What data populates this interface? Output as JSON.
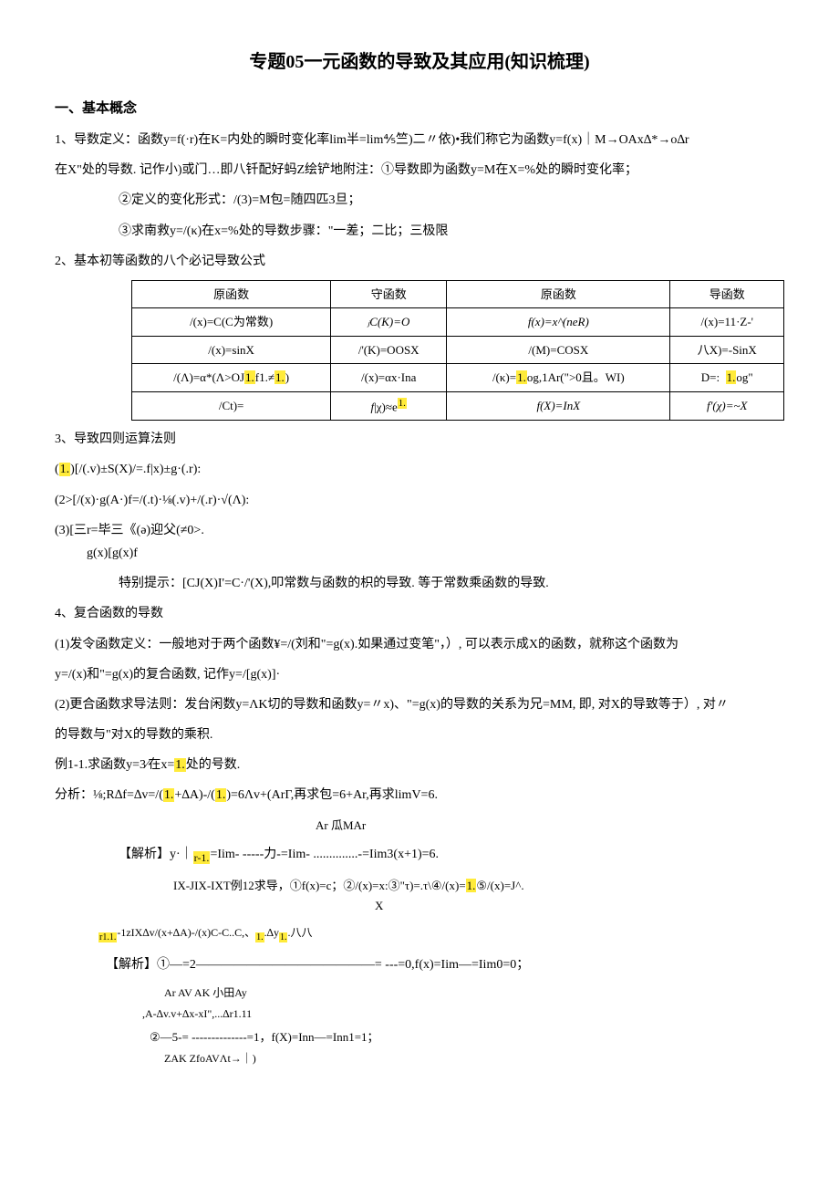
{
  "title": "专题05一元函数的导致及其应用(知识梳理)",
  "sec1": {
    "heading": "一、基本概念",
    "p1": "1、导数定义：函数y=f(·r)在K=内处的瞬时变化率lim半=lim⅘竺)二〃依)•我们称它为函数y=f(x)｜M→OAx∆*→o∆r",
    "p2": "在X\"处的导数. 记作小)或门…即八钎配好蚂Z绘铲地附注：①导数即为函数y=M在X=%处的瞬时变化率；",
    "p3": "②定义的变化形式：/(3)=M包=随四匹3旦；",
    "p4": "③求南救y=/(κ)在x=%处的导数步骤：\"一差；二比；三极限",
    "p5": "2、基本初等函数的八个必记导致公式"
  },
  "table": {
    "headers": [
      "原函数",
      "守函数",
      "原函数",
      "导函数"
    ],
    "rows": [
      [
        "/(x)=C(C为常数)",
        "ⱼC(K)=O",
        "f(x)=x^(neR)",
        "/(x)=11·Z-'"
      ],
      [
        "/(x)=sinX",
        "/'(K)=OOSX",
        "/(M)=COSX",
        "八X)=-SinX"
      ],
      [
        "/(Λ)=α*(Λ>OJ1.f1.≠1.)",
        "/(x)=αx·Ina",
        "/(κ)=1.og,1Ar(\">0且。WI)",
        "D=: 1.og\""
      ],
      [
        "/Ct)=",
        "f|χ)≈e1.",
        "f(X)=InX",
        "f'(χ)=~X"
      ]
    ],
    "hl": {
      "r2c0a": "1.",
      "r2c0b": "1.",
      "r2c2": "1.",
      "r2c3": "1.",
      "r3c1": "1."
    }
  },
  "sec3": {
    "p1": "3、导致四则运算法则",
    "p2a": "(",
    "p2hl": "1.",
    "p2b": ")[/(.v)±S(X)/=.f|x)±g·(.r):",
    "p3": "(2>[/(x)·g(A·)f=/(.t)·⅛(.v)+/(.r)·√(Λ):",
    "p4a": "(3)[三r=毕三《(ə)迎父(≠0>.",
    "p4b": "g(x)[g(x)f",
    "p5": "特别提示：[CJ(X)I'=C·/'(X),叩常数与函数的枳的导致. 等于常数乘函数的导致.",
    "p6": "4、复合函数的导数"
  },
  "sec4": {
    "p1": "(1)发令函数定义：一般地对于两个函数¥=/(刘和\"=g(x).如果通过变笔\"，）, 可以表示成X的函数，就称这个函数为",
    "p2": "y=/(x)和\"=g(x)的复合函数, 记作y=/[g(x)]·",
    "p3": "(2)更合函数求导法则：发台闲数y=ΛK切的导数和函数y=〃x)、\"=g(x)的导数的关系为兄=MM, 即, 对X的导致等于）, 对〃",
    "p4": "的导数与\"对X的导数的乘积.",
    "ex1a": "例1-1.求函数y=3⁄在x=",
    "ex1hl": "1.",
    "ex1b": "处的号数.",
    "ana_a": "分析：⅛;R∆f=∆v=/(",
    "ana_hl1": "1.",
    "ana_b": "+∆A)-/(",
    "ana_hl2": "1.",
    "ana_c": ")=6Λv+(ArΓ,再求包=6+Ar,再求limV=6.",
    "ana_line2": "Ar                           瓜MAr",
    "sol1a": "【解析】y·｜",
    "sol1hl": "r-1.",
    "sol1b": "=Iim- -----力-=Iim- ..............-=Iim3(x+1)=6.",
    "sol1c": "IX-JIX-IXT例12求导，①f(x)=c；②/(x)=x:③\"τ)=.τ\\④/(x)=",
    "sol1hl2": "1.",
    "sol1d": "⑤/(x)=J^.",
    "sol1x": "X",
    "sol2hl": "r1.1.",
    "sol2a": "-1zIX∆v/(x+∆A)-/(x)C-C..C,、",
    "sol2hl2": "1.",
    "sol2b": "∆y",
    "sol2hl3": "1.",
    "sol2c": ".八八",
    "sol3": "【解析】①—=2——————————————= ---=0,f(x)=Iim—=Iim0=0；",
    "sol3line": "Ar              AV              AK                    小田Ay",
    "sol4a": ",A-∆v.v+∆x-xI\",...∆r1.11",
    "sol4b": "②—5-= --------------=1，f(X)=Inn—=Inn1=1；",
    "sol4line": "ZAK                              ZfoAVΛt→｜)"
  }
}
